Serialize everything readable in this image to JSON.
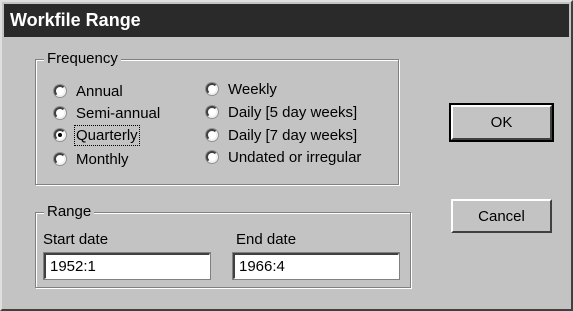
{
  "window": {
    "title": "Workfile Range"
  },
  "frequency": {
    "label": "Frequency",
    "options_left": [
      {
        "label": "Annual",
        "selected": false
      },
      {
        "label": "Semi-annual",
        "selected": false
      },
      {
        "label": "Quarterly",
        "selected": true
      },
      {
        "label": "Monthly",
        "selected": false
      }
    ],
    "options_right": [
      {
        "label": "Weekly",
        "selected": false
      },
      {
        "label": "Daily [5 day weeks]",
        "selected": false
      },
      {
        "label": "Daily [7 day weeks]",
        "selected": false
      },
      {
        "label": "Undated or irregular",
        "selected": false
      }
    ]
  },
  "range": {
    "label": "Range",
    "start_label": "Start date",
    "start_value": "1952:1",
    "end_label": "End date",
    "end_value": "1966:4"
  },
  "buttons": {
    "ok": "OK",
    "cancel": "Cancel"
  }
}
